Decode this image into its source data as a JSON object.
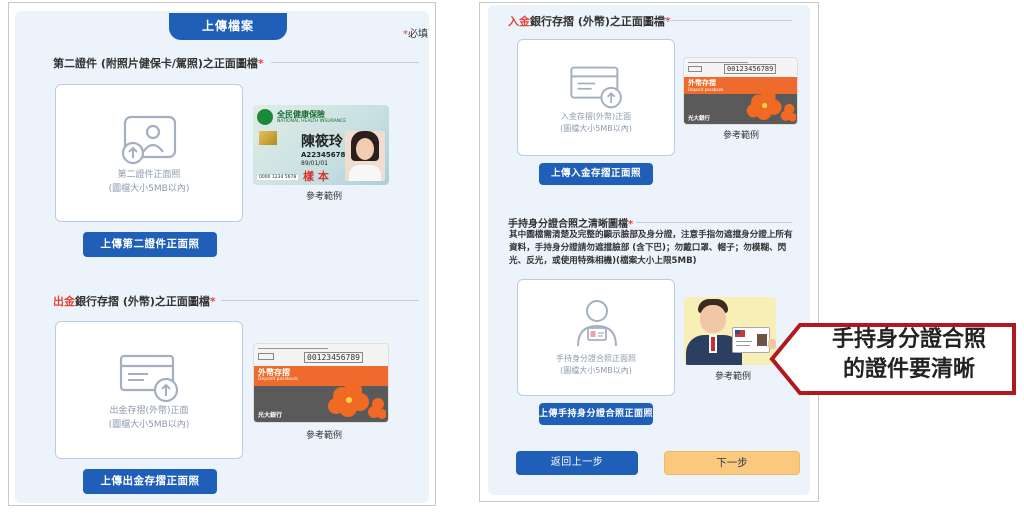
{
  "left": {
    "top_button": "上傳檔案",
    "required_note": "必填",
    "required_star": "*",
    "section1": {
      "title": "第二證件 (附照片健保卡/駕照)之正面圖檔",
      "upload_hint_line1": "第二證件正面照",
      "upload_hint_line2": "(圖檔大小5MB以內)",
      "button": "上傳第二證件正面照",
      "sample_label": "參考範例",
      "card": {
        "header": "全民健康保險",
        "header_en": "NATIONAL HEALTH INSURANCE",
        "name": "陳筱玲",
        "id": "A223456789",
        "dob": "89/01/01",
        "stamp": "樣 本",
        "serial": "0000 1234 5678"
      }
    },
    "section2": {
      "title_red": "出金",
      "title_rest": "銀行存摺 (外幣)之正面圖檔",
      "upload_hint_line1": "出金存摺(外幣)正面",
      "upload_hint_line2": "(圖檔大小5MB以內)",
      "button": "上傳出金存摺正面照",
      "sample_label": "參考範例",
      "passbook": {
        "account": "00123456789",
        "title": "外幣存摺",
        "subtitle": "Deposit passbook",
        "bank": "光大銀行"
      }
    }
  },
  "right": {
    "section1": {
      "title_red": "入金",
      "title_rest": "銀行存摺 (外幣)之正面圖檔",
      "upload_hint_line1": "入金存摺(外幣)正面",
      "upload_hint_line2": "(圖檔大小5MB以內)",
      "button": "上傳入金存摺正面照",
      "sample_label": "參考範例",
      "passbook": {
        "account": "00123456789",
        "title": "外幣存摺",
        "subtitle": "Deposit passbook",
        "bank": "光大銀行"
      }
    },
    "section2": {
      "title": "手持身分證合照之清晰圖檔",
      "description": "其中圖檔需清楚及完整的顯示臉部及身分證，注意手指勿遮擋身分證上所有資料，手持身分證請勿遮擋臉部 (含下巴)；勿戴口罩、帽子；勿模糊、閃光、反光，或使用特殊相機)(檔案大小上限5MB)",
      "upload_hint_line1": "手持身分證合照正面照",
      "upload_hint_line2": "(圖檔大小5MB以內)",
      "button": "上傳手持身分證合照正面照",
      "sample_label": "參考範例"
    },
    "back_button": "返回上一步",
    "next_button": "下一步"
  },
  "callout": {
    "line1": "手持身分證合照",
    "line2": "的證件要清晰"
  },
  "colors": {
    "primary": "#1f5fb8",
    "secondary_button": "#fbc97e",
    "required": "#e1453b",
    "callout_border": "#b0191e"
  }
}
